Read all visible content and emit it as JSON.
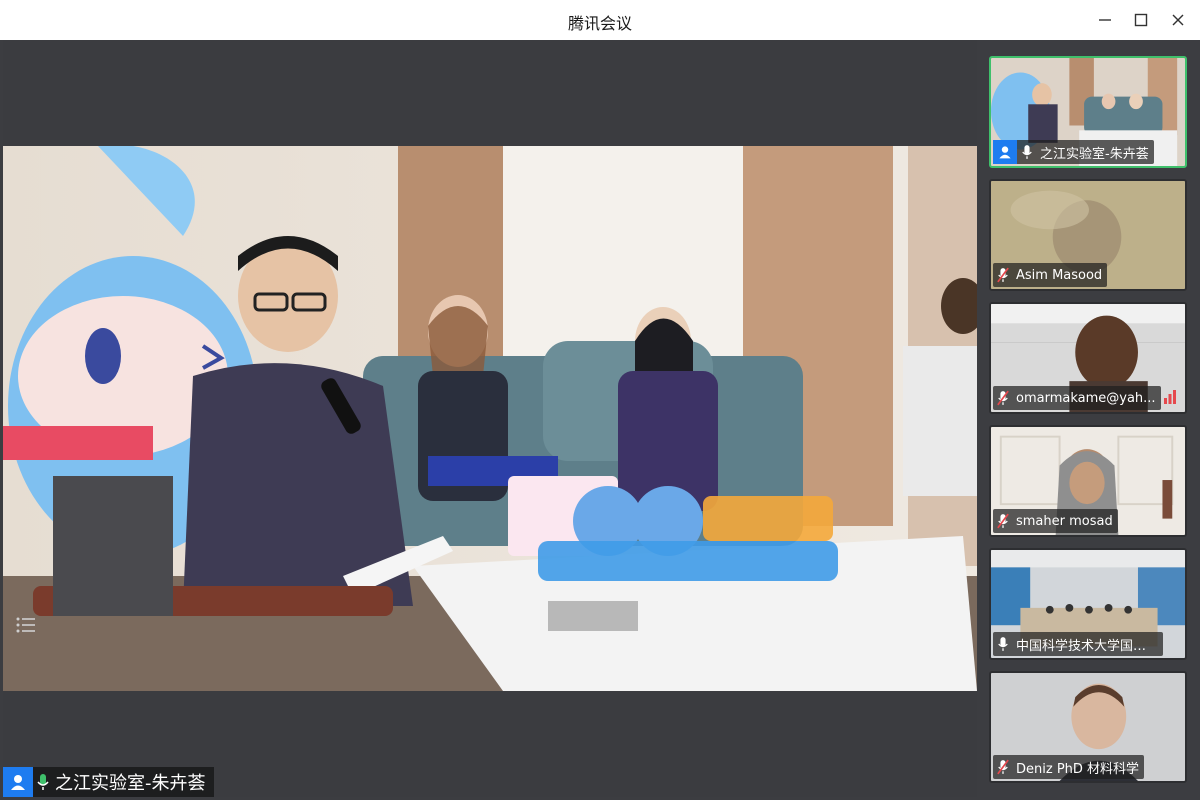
{
  "window": {
    "title": "腾讯会议"
  },
  "main_video": {
    "speaker_name": "之江实验室-朱卉荟"
  },
  "participants": [
    {
      "name": "之江实验室-朱卉荟",
      "mic": "on",
      "active": true
    },
    {
      "name": "Asim Masood",
      "mic": "muted"
    },
    {
      "name": "omarmakame@yah...",
      "mic": "muted",
      "signal": true
    },
    {
      "name": "smaher mosad",
      "mic": "muted"
    },
    {
      "name": "中国科学技术大学国际学院",
      "mic": "on"
    },
    {
      "name": "Deniz PhD 材料科学",
      "mic": "muted"
    }
  ],
  "colors": {
    "accent": "#1e7cf0",
    "active_border": "#3fc06b",
    "muted": "#e5484d",
    "mic_on": "#3fc06b"
  }
}
